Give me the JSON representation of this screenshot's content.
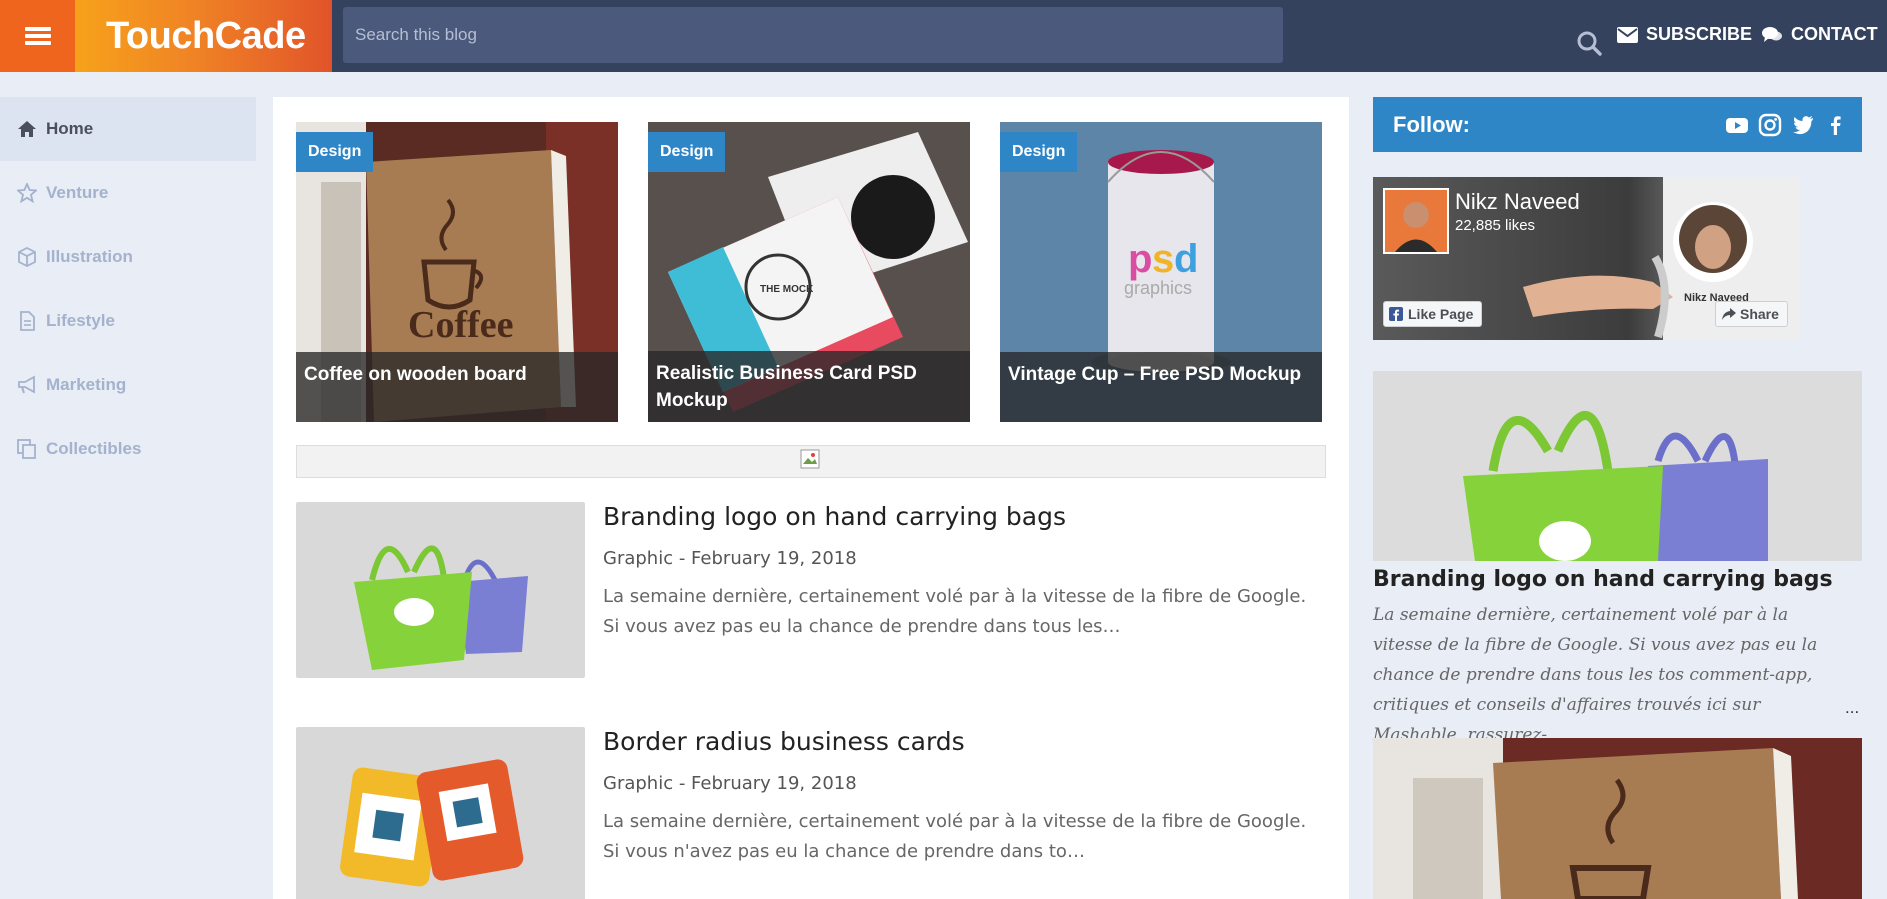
{
  "header": {
    "menu_icon": "hamburger-menu-icon",
    "logo": "TouchCade",
    "search_placeholder": "Search this blog",
    "search_icon": "search-icon",
    "subscribe": "SUBSCRIBE",
    "contact": "CONTACT",
    "colors": {
      "bar": "#34425e",
      "menu": "#f0651e",
      "accent": "#2f86c7"
    }
  },
  "sidebar": {
    "items": [
      {
        "label": "Home",
        "icon": "home-icon",
        "active": true
      },
      {
        "label": "Venture",
        "icon": "star-icon",
        "active": false
      },
      {
        "label": "Illustration",
        "icon": "cube-icon",
        "active": false
      },
      {
        "label": "Lifestyle",
        "icon": "document-icon",
        "active": false
      },
      {
        "label": "Marketing",
        "icon": "megaphone-icon",
        "active": false
      },
      {
        "label": "Collectibles",
        "icon": "copy-icon",
        "active": false
      }
    ]
  },
  "featured": [
    {
      "tag": "Design",
      "title": "Coffee on wooden board"
    },
    {
      "tag": "Design",
      "title": "Realistic Business Card PSD Mockup"
    },
    {
      "tag": "Design",
      "title": "Vintage Cup – Free PSD Mockup"
    }
  ],
  "posts": [
    {
      "title": "Branding logo on hand carrying bags",
      "meta": "Graphic - February 19, 2018",
      "excerpt": "La semaine dernière, certainement volé par à la vitesse de la fibre de Google. Si vous avez pas eu la chance de prendre dans tous les…"
    },
    {
      "title": "Border radius business cards",
      "meta": "Graphic - February 19, 2018",
      "excerpt": "La semaine dernière, certainement volé par à la vitesse de la fibre de Google. Si vous n'avez pas eu la chance de prendre dans to…"
    }
  ],
  "right": {
    "follow_label": "Follow:",
    "social_icons": [
      "youtube-icon",
      "instagram-icon",
      "twitter-icon",
      "facebook-icon"
    ],
    "fb": {
      "name": "Nikz Naveed",
      "likes": "22,885 likes",
      "like_btn": "Like Page",
      "share_btn": "Share",
      "cover_name": "Nikz Naveed"
    },
    "post": {
      "title": "Branding logo on hand carrying bags",
      "excerpt": "La semaine dernière, certainement volé par à la vitesse de la fibre de Google. Si vous avez pas eu la chance de prendre dans tous les tos comment-app, critiques et conseils d'affaires trouvés ici sur Mashable, rassurez-",
      "more": "..."
    }
  }
}
